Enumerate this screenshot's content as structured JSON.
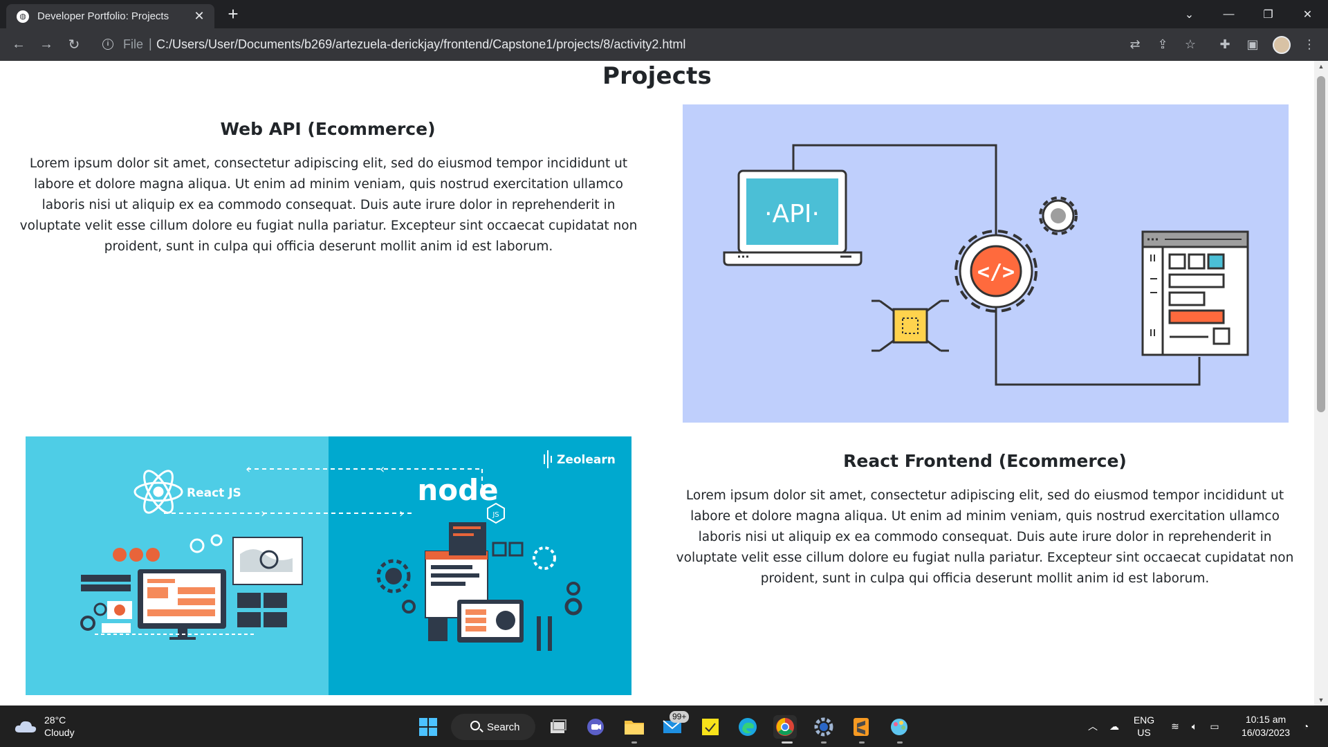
{
  "browser": {
    "tab_title": "Developer Portfolio: Projects",
    "tab_close": "✕",
    "new_tab": "+",
    "url_scheme": "File",
    "url_separator": "|",
    "url": "C:/Users/User/Documents/b269/artezuela-derickjay/frontend/Capstone1/projects/8/activity2.html",
    "icons": [
      "back-icon",
      "forward-icon",
      "reload-icon",
      "info-icon",
      "translate-icon",
      "share-icon",
      "star-icon",
      "extensions-icon",
      "side-panel-icon",
      "profile-avatar",
      "menu-icon"
    ]
  },
  "page": {
    "title": "Projects",
    "projects": [
      {
        "title": "Web API (Ecommerce)",
        "description": "Lorem ipsum dolor sit amet, consectetur adipiscing elit, sed do eiusmod tempor incididunt ut labore et dolore magna aliqua. Ut enim ad minim veniam, quis nostrud exercitation ullamco laboris nisi ut aliquip ex ea commodo consequat. Duis aute irure dolor in reprehenderit in voluptate velit esse cillum dolore eu fugiat nulla pariatur. Excepteur sint occaecat cupidatat non proident, sunt in culpa qui officia deserunt mollit anim id est laborum.",
        "image_text": "·API·"
      },
      {
        "title": "React Frontend (Ecommerce)",
        "description": "Lorem ipsum dolor sit amet, consectetur adipiscing elit, sed do eiusmod tempor incididunt ut labore et dolore magna aliqua. Ut enim ad minim veniam, quis nostrud exercitation ullamco laboris nisi ut aliquip ex ea commodo consequat. Duis aute irure dolor in reprehenderit in voluptate velit esse cillum dolore eu fugiat nulla pariatur. Excepteur sint occaecat cupidatat non proident, sunt in culpa qui officia deserunt mollit anim id est laborum.",
        "image_react_label": "React JS",
        "image_node_label": "node",
        "image_js_label": "JS",
        "image_brand": "Zeolearn"
      }
    ]
  },
  "taskbar": {
    "weather_temp": "28°C",
    "weather_desc": "Cloudy",
    "search_label": "Search",
    "mail_badge": "99+",
    "lang_top": "ENG",
    "lang_bottom": "US",
    "time": "10:15 am",
    "date": "16/03/2023"
  },
  "colors": {
    "api_bg": "#bfcffc",
    "api_screen": "#4bbfd6",
    "api_code_orange": "#ff6a3d",
    "chip_yellow": "#ffd34d",
    "react_bg_left": "#4ecde6",
    "react_bg_right": "#00a9cf",
    "chrome_dark": "#202124",
    "taskbar": "#202020"
  }
}
